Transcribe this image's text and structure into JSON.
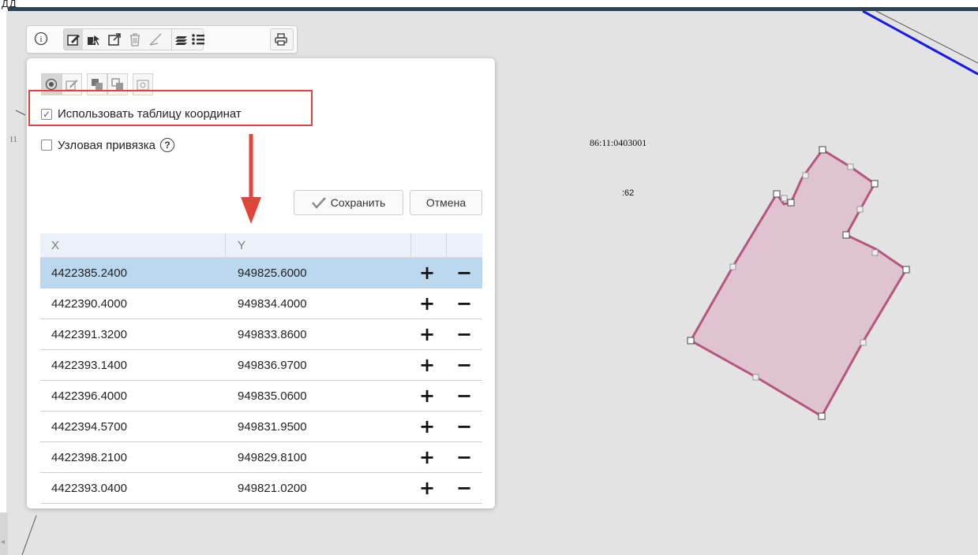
{
  "top": {
    "stray_text": "ДД"
  },
  "toolbar": {
    "icons": [
      "info-icon",
      "edit-icon",
      "select-object-icon",
      "external-link-icon",
      "trash-icon",
      "measure-icon",
      "layers-icon",
      "list-icon",
      "print-icon"
    ]
  },
  "editor": {
    "mode_icons": [
      "point-mode-icon",
      "edit-mode-icon",
      "union-icon",
      "intersect-icon",
      "snapshot-icon"
    ],
    "use_coordinate_table": {
      "label": "Использовать таблицу координат",
      "checked": true
    },
    "node_snap": {
      "label": "Узловая привязка",
      "checked": false,
      "help_glyph": "?"
    },
    "save_label": "Сохранить",
    "cancel_label": "Отмена",
    "table": {
      "headers": [
        "X",
        "Y"
      ],
      "add_glyph": "+",
      "remove_glyph": "−",
      "selected_row": 0,
      "rows": [
        {
          "x": "4422385.2400",
          "y": "949825.6000"
        },
        {
          "x": "4422390.4000",
          "y": "949834.4000"
        },
        {
          "x": "4422391.3200",
          "y": "949833.8600"
        },
        {
          "x": "4422393.1400",
          "y": "949836.9700"
        },
        {
          "x": "4422396.4000",
          "y": "949835.0600"
        },
        {
          "x": "4422394.5700",
          "y": "949831.9500"
        },
        {
          "x": "4422398.2100",
          "y": "949829.8100"
        },
        {
          "x": "4422393.0400",
          "y": "949821.0200"
        }
      ]
    }
  },
  "map": {
    "cadastral_number": "86:11:0403001",
    "parcel_label": ":62",
    "edge_label": "11",
    "polygon_fill": "#e0c3d0",
    "polygon_stroke": "#b5567f",
    "boundary_color": "#1a1ae6"
  },
  "colors": {
    "highlight": "#e0443a",
    "selected_row": "#bcd8ee",
    "header_row": "#eaf1f8"
  }
}
